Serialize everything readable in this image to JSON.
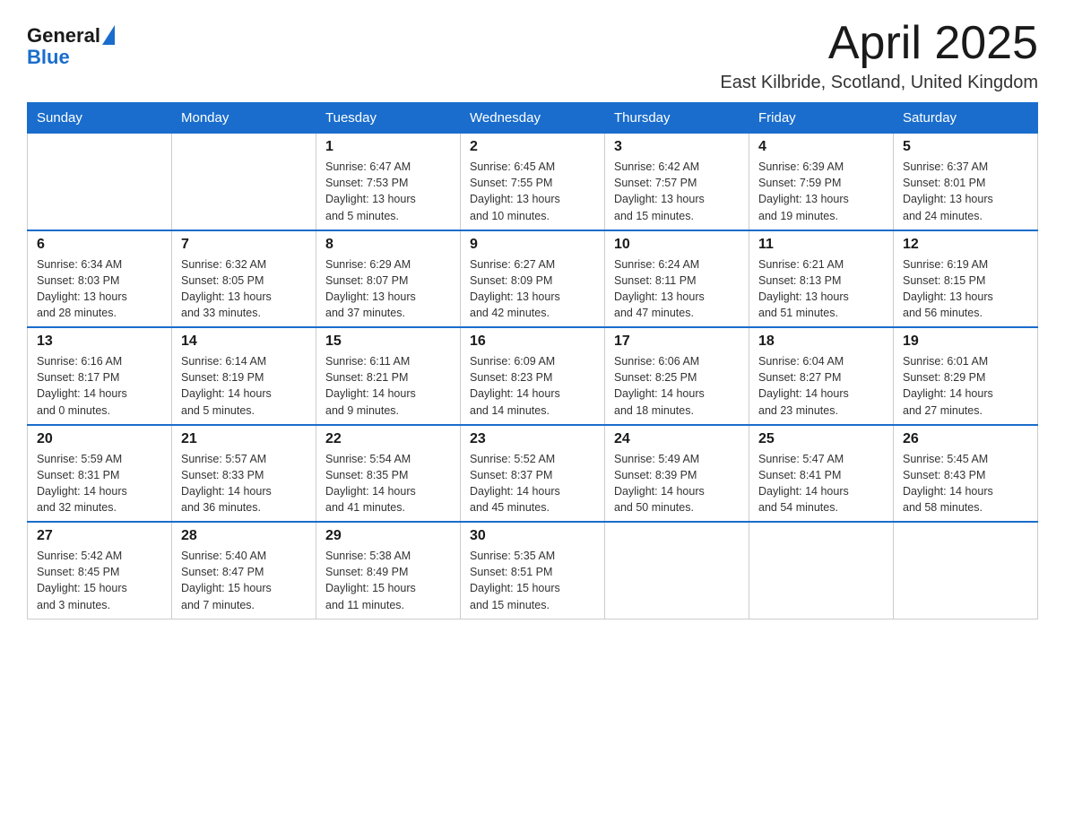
{
  "header": {
    "logo_general": "General",
    "logo_blue": "Blue",
    "month_title": "April 2025",
    "location": "East Kilbride, Scotland, United Kingdom"
  },
  "weekdays": [
    "Sunday",
    "Monday",
    "Tuesday",
    "Wednesday",
    "Thursday",
    "Friday",
    "Saturday"
  ],
  "weeks": [
    [
      {
        "day": "",
        "info": ""
      },
      {
        "day": "",
        "info": ""
      },
      {
        "day": "1",
        "info": "Sunrise: 6:47 AM\nSunset: 7:53 PM\nDaylight: 13 hours\nand 5 minutes."
      },
      {
        "day": "2",
        "info": "Sunrise: 6:45 AM\nSunset: 7:55 PM\nDaylight: 13 hours\nand 10 minutes."
      },
      {
        "day": "3",
        "info": "Sunrise: 6:42 AM\nSunset: 7:57 PM\nDaylight: 13 hours\nand 15 minutes."
      },
      {
        "day": "4",
        "info": "Sunrise: 6:39 AM\nSunset: 7:59 PM\nDaylight: 13 hours\nand 19 minutes."
      },
      {
        "day": "5",
        "info": "Sunrise: 6:37 AM\nSunset: 8:01 PM\nDaylight: 13 hours\nand 24 minutes."
      }
    ],
    [
      {
        "day": "6",
        "info": "Sunrise: 6:34 AM\nSunset: 8:03 PM\nDaylight: 13 hours\nand 28 minutes."
      },
      {
        "day": "7",
        "info": "Sunrise: 6:32 AM\nSunset: 8:05 PM\nDaylight: 13 hours\nand 33 minutes."
      },
      {
        "day": "8",
        "info": "Sunrise: 6:29 AM\nSunset: 8:07 PM\nDaylight: 13 hours\nand 37 minutes."
      },
      {
        "day": "9",
        "info": "Sunrise: 6:27 AM\nSunset: 8:09 PM\nDaylight: 13 hours\nand 42 minutes."
      },
      {
        "day": "10",
        "info": "Sunrise: 6:24 AM\nSunset: 8:11 PM\nDaylight: 13 hours\nand 47 minutes."
      },
      {
        "day": "11",
        "info": "Sunrise: 6:21 AM\nSunset: 8:13 PM\nDaylight: 13 hours\nand 51 minutes."
      },
      {
        "day": "12",
        "info": "Sunrise: 6:19 AM\nSunset: 8:15 PM\nDaylight: 13 hours\nand 56 minutes."
      }
    ],
    [
      {
        "day": "13",
        "info": "Sunrise: 6:16 AM\nSunset: 8:17 PM\nDaylight: 14 hours\nand 0 minutes."
      },
      {
        "day": "14",
        "info": "Sunrise: 6:14 AM\nSunset: 8:19 PM\nDaylight: 14 hours\nand 5 minutes."
      },
      {
        "day": "15",
        "info": "Sunrise: 6:11 AM\nSunset: 8:21 PM\nDaylight: 14 hours\nand 9 minutes."
      },
      {
        "day": "16",
        "info": "Sunrise: 6:09 AM\nSunset: 8:23 PM\nDaylight: 14 hours\nand 14 minutes."
      },
      {
        "day": "17",
        "info": "Sunrise: 6:06 AM\nSunset: 8:25 PM\nDaylight: 14 hours\nand 18 minutes."
      },
      {
        "day": "18",
        "info": "Sunrise: 6:04 AM\nSunset: 8:27 PM\nDaylight: 14 hours\nand 23 minutes."
      },
      {
        "day": "19",
        "info": "Sunrise: 6:01 AM\nSunset: 8:29 PM\nDaylight: 14 hours\nand 27 minutes."
      }
    ],
    [
      {
        "day": "20",
        "info": "Sunrise: 5:59 AM\nSunset: 8:31 PM\nDaylight: 14 hours\nand 32 minutes."
      },
      {
        "day": "21",
        "info": "Sunrise: 5:57 AM\nSunset: 8:33 PM\nDaylight: 14 hours\nand 36 minutes."
      },
      {
        "day": "22",
        "info": "Sunrise: 5:54 AM\nSunset: 8:35 PM\nDaylight: 14 hours\nand 41 minutes."
      },
      {
        "day": "23",
        "info": "Sunrise: 5:52 AM\nSunset: 8:37 PM\nDaylight: 14 hours\nand 45 minutes."
      },
      {
        "day": "24",
        "info": "Sunrise: 5:49 AM\nSunset: 8:39 PM\nDaylight: 14 hours\nand 50 minutes."
      },
      {
        "day": "25",
        "info": "Sunrise: 5:47 AM\nSunset: 8:41 PM\nDaylight: 14 hours\nand 54 minutes."
      },
      {
        "day": "26",
        "info": "Sunrise: 5:45 AM\nSunset: 8:43 PM\nDaylight: 14 hours\nand 58 minutes."
      }
    ],
    [
      {
        "day": "27",
        "info": "Sunrise: 5:42 AM\nSunset: 8:45 PM\nDaylight: 15 hours\nand 3 minutes."
      },
      {
        "day": "28",
        "info": "Sunrise: 5:40 AM\nSunset: 8:47 PM\nDaylight: 15 hours\nand 7 minutes."
      },
      {
        "day": "29",
        "info": "Sunrise: 5:38 AM\nSunset: 8:49 PM\nDaylight: 15 hours\nand 11 minutes."
      },
      {
        "day": "30",
        "info": "Sunrise: 5:35 AM\nSunset: 8:51 PM\nDaylight: 15 hours\nand 15 minutes."
      },
      {
        "day": "",
        "info": ""
      },
      {
        "day": "",
        "info": ""
      },
      {
        "day": "",
        "info": ""
      }
    ]
  ]
}
